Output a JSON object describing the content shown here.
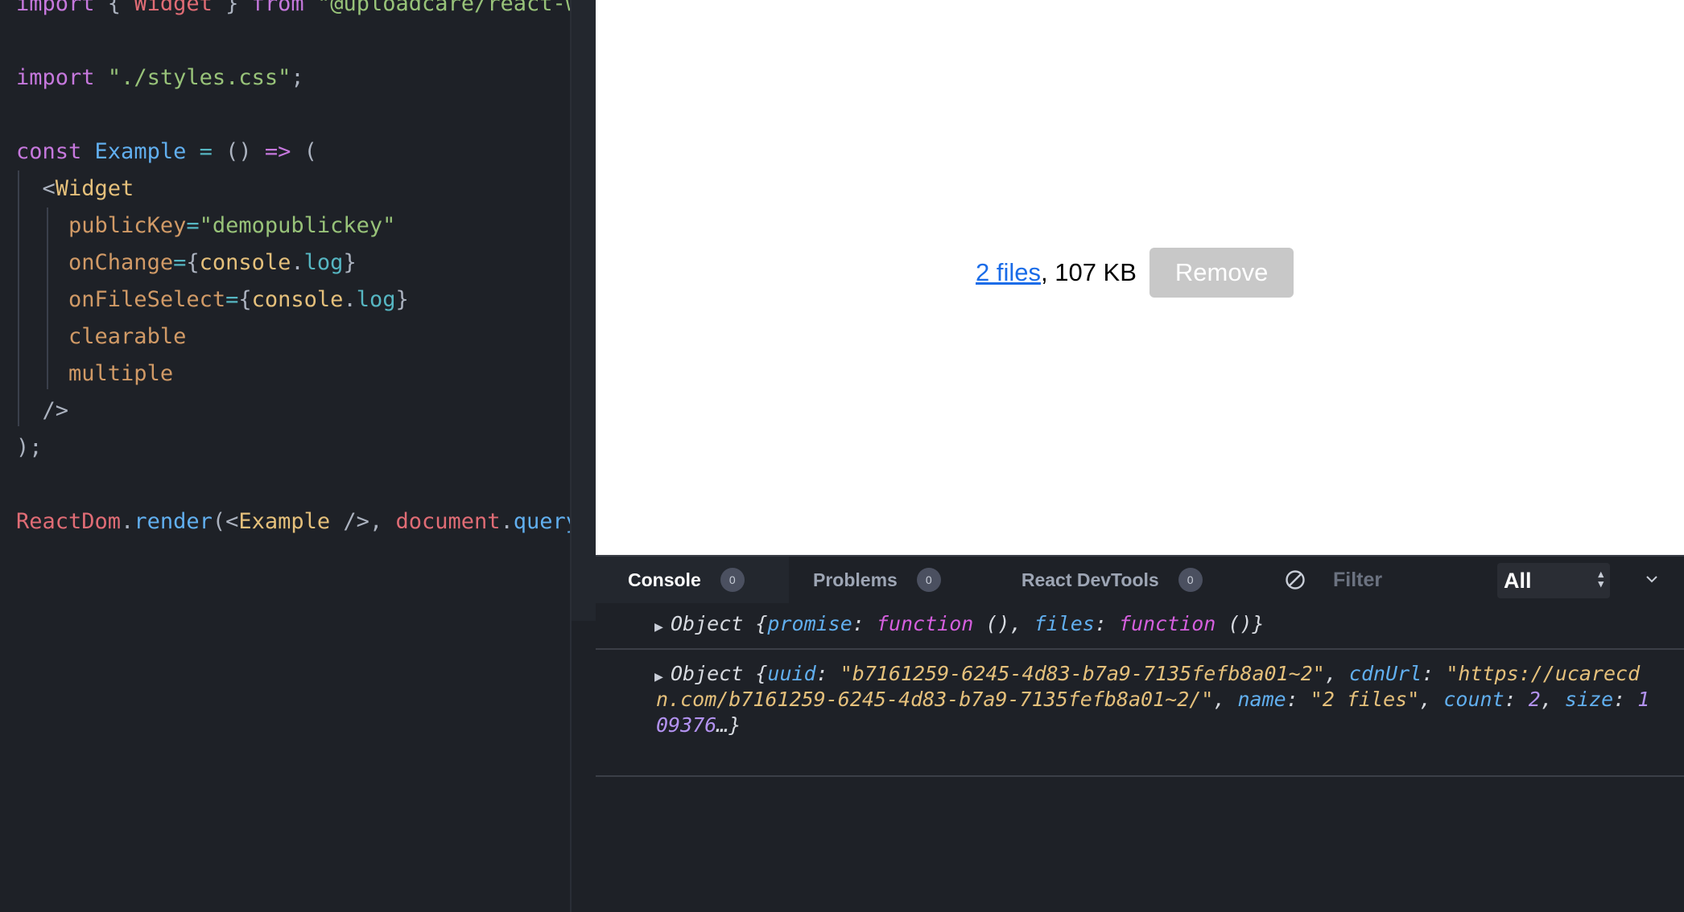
{
  "editor": {
    "lines": [
      {
        "tokens": [
          {
            "c": "k",
            "t": "import"
          },
          {
            "c": "p",
            "t": " { "
          },
          {
            "c": "r",
            "t": "Widget"
          },
          {
            "c": "p",
            "t": " } "
          },
          {
            "c": "k",
            "t": "from"
          },
          {
            "c": "p",
            "t": " "
          },
          {
            "c": "s",
            "t": "\"@uploadcare/react-w"
          }
        ]
      },
      {
        "tokens": []
      },
      {
        "tokens": [
          {
            "c": "k",
            "t": "import"
          },
          {
            "c": "p",
            "t": " "
          },
          {
            "c": "s",
            "t": "\"./styles.css\""
          },
          {
            "c": "p",
            "t": ";"
          }
        ]
      },
      {
        "tokens": []
      },
      {
        "tokens": [
          {
            "c": "k",
            "t": "const"
          },
          {
            "c": "p",
            "t": " "
          },
          {
            "c": "f",
            "t": "Example"
          },
          {
            "c": "p",
            "t": " "
          },
          {
            "c": "o",
            "t": "="
          },
          {
            "c": "p",
            "t": " () "
          },
          {
            "c": "k",
            "t": "=>"
          },
          {
            "c": "p",
            "t": " ("
          }
        ]
      },
      {
        "tokens": [
          {
            "c": "p",
            "t": "  <"
          },
          {
            "c": "t",
            "t": "Widget"
          }
        ]
      },
      {
        "tokens": [
          {
            "c": "p",
            "t": "    "
          },
          {
            "c": "a",
            "t": "publicKey"
          },
          {
            "c": "o",
            "t": "="
          },
          {
            "c": "s",
            "t": "\"demopublickey\""
          }
        ]
      },
      {
        "tokens": [
          {
            "c": "p",
            "t": "    "
          },
          {
            "c": "a",
            "t": "onChange"
          },
          {
            "c": "o",
            "t": "="
          },
          {
            "c": "p",
            "t": "{"
          },
          {
            "c": "t",
            "t": "console"
          },
          {
            "c": "p",
            "t": "."
          },
          {
            "c": "o",
            "t": "log"
          },
          {
            "c": "p",
            "t": "}"
          }
        ]
      },
      {
        "tokens": [
          {
            "c": "p",
            "t": "    "
          },
          {
            "c": "a",
            "t": "onFileSelect"
          },
          {
            "c": "o",
            "t": "="
          },
          {
            "c": "p",
            "t": "{"
          },
          {
            "c": "t",
            "t": "console"
          },
          {
            "c": "p",
            "t": "."
          },
          {
            "c": "o",
            "t": "log"
          },
          {
            "c": "p",
            "t": "}"
          }
        ]
      },
      {
        "tokens": [
          {
            "c": "p",
            "t": "    "
          },
          {
            "c": "a",
            "t": "clearable"
          }
        ]
      },
      {
        "tokens": [
          {
            "c": "p",
            "t": "    "
          },
          {
            "c": "a",
            "t": "multiple"
          }
        ]
      },
      {
        "tokens": [
          {
            "c": "p",
            "t": "  />"
          }
        ]
      },
      {
        "tokens": [
          {
            "c": "p",
            "t": ");"
          }
        ]
      },
      {
        "tokens": []
      },
      {
        "tokens": [
          {
            "c": "r",
            "t": "ReactDom"
          },
          {
            "c": "p",
            "t": "."
          },
          {
            "c": "f",
            "t": "render"
          },
          {
            "c": "p",
            "t": "(<"
          },
          {
            "c": "t",
            "t": "Example"
          },
          {
            "c": "p",
            "t": " />, "
          },
          {
            "c": "r",
            "t": "document"
          },
          {
            "c": "p",
            "t": "."
          },
          {
            "c": "f",
            "t": "queryS"
          }
        ]
      }
    ]
  },
  "preview": {
    "files_link": "2 files",
    "size_text": ", 107 KB",
    "remove_label": "Remove"
  },
  "devtools": {
    "tabs": [
      {
        "label": "Console",
        "count": "0"
      },
      {
        "label": "Problems",
        "count": "0"
      },
      {
        "label": "React DevTools",
        "count": "0"
      }
    ],
    "filter_placeholder": "Filter",
    "level": "All",
    "logs": [
      {
        "tokens": [
          {
            "c": "",
            "t": "Object {"
          },
          {
            "c": "lk",
            "t": "promise"
          },
          {
            "c": "",
            "t": ": "
          },
          {
            "c": "lfn",
            "t": "function"
          },
          {
            "c": "",
            "t": " (), "
          },
          {
            "c": "lk",
            "t": "files"
          },
          {
            "c": "",
            "t": ": "
          },
          {
            "c": "lfn",
            "t": "function"
          },
          {
            "c": "",
            "t": " ()}"
          }
        ]
      },
      {
        "tokens": [
          {
            "c": "",
            "t": "Object {"
          },
          {
            "c": "lk",
            "t": "uuid"
          },
          {
            "c": "",
            "t": ": "
          },
          {
            "c": "ls",
            "t": "\"b7161259-6245-4d83-b7a9-7135fefb8a01~2\""
          },
          {
            "c": "",
            "t": ", "
          },
          {
            "c": "lk",
            "t": "cdnUrl"
          },
          {
            "c": "",
            "t": ": "
          },
          {
            "c": "ls",
            "t": "\"https://ucarecdn.com/b7161259-6245-4d83-b7a9-7135fefb8a01~2/\""
          },
          {
            "c": "",
            "t": ", "
          },
          {
            "c": "lk",
            "t": "name"
          },
          {
            "c": "",
            "t": ": "
          },
          {
            "c": "ls",
            "t": "\"2 files\""
          },
          {
            "c": "",
            "t": ", "
          },
          {
            "c": "lk",
            "t": "count"
          },
          {
            "c": "",
            "t": ": "
          },
          {
            "c": "ln",
            "t": "2"
          },
          {
            "c": "",
            "t": ", "
          },
          {
            "c": "lk",
            "t": "size"
          },
          {
            "c": "",
            "t": ": "
          },
          {
            "c": "ln",
            "t": "109376"
          },
          {
            "c": "",
            "t": "…}"
          }
        ]
      }
    ]
  }
}
